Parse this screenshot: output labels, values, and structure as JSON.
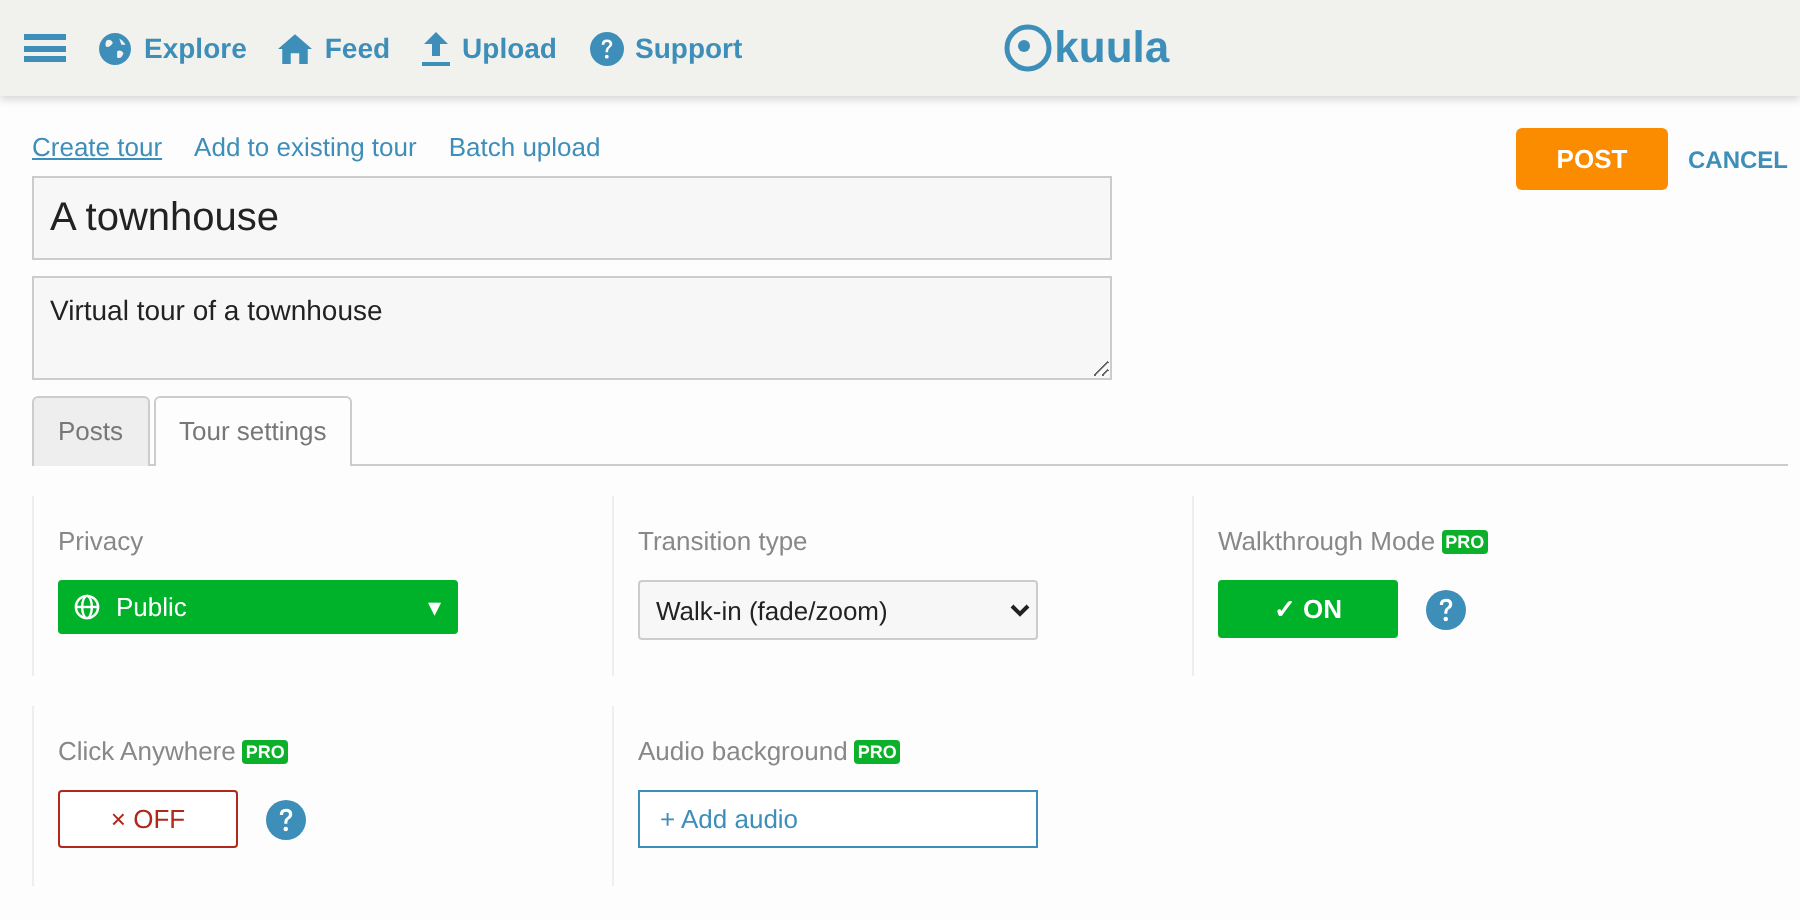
{
  "nav": [
    {
      "label": "Explore"
    },
    {
      "label": "Feed"
    },
    {
      "label": "Upload"
    },
    {
      "label": "Support"
    }
  ],
  "logo": {
    "text": "kuula"
  },
  "mode_links": [
    {
      "label": "Create tour",
      "selected": true
    },
    {
      "label": "Add to existing tour",
      "selected": false
    },
    {
      "label": "Batch upload",
      "selected": false
    }
  ],
  "actions": {
    "post": "POST",
    "cancel": "CANCEL"
  },
  "title_field": {
    "value": "A townhouse"
  },
  "description_field": {
    "value": "Virtual tour of a townhouse"
  },
  "tabs": [
    {
      "label": "Posts",
      "selected": false
    },
    {
      "label": "Tour settings",
      "selected": true
    }
  ],
  "settings": [
    {
      "kind": "dropdown",
      "label": "Privacy",
      "value": "Public",
      "caret": "▾"
    },
    {
      "kind": "select",
      "label": "Transition type",
      "value": "Walk-in (fade/zoom)"
    },
    {
      "kind": "toggle",
      "label": "Walkthrough Mode",
      "pro_label": "PRO",
      "on": true,
      "value": "✓ ON"
    },
    {
      "kind": "toggle",
      "label": "Click Anywhere",
      "pro_label": "PRO",
      "on": false,
      "value": "× OFF"
    },
    {
      "kind": "add",
      "label": "Audio background",
      "pro_label": "PRO",
      "value": "+ Add audio"
    }
  ]
}
